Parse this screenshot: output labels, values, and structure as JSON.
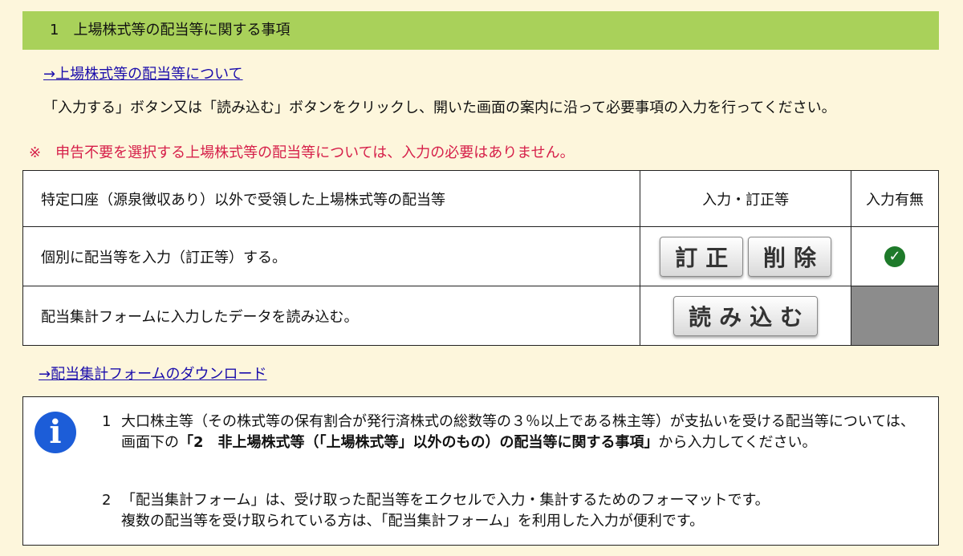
{
  "section": {
    "title": "1　上場株式等の配当等に関する事項",
    "about_link": "→上場株式等の配当等について",
    "instruction": "「入力する」ボタン又は「読み込む」ボタンをクリックし、開いた画面の案内に沿って必要事項の入力を行ってください。",
    "notice_mark": "※",
    "notice": "申告不要を選択する上場株式等の配当等については、入力の必要はありません。"
  },
  "table": {
    "headers": [
      "特定口座（源泉徴収あり）以外で受領した上場株式等の配当等",
      "入力・訂正等",
      "入力有無"
    ],
    "row1_label": "個別に配当等を入力（訂正等）する。",
    "row1_buttons": [
      "訂正",
      "削除"
    ],
    "row1_status": "✓",
    "row2_label": "配当集計フォームに入力したデータを読み込む。",
    "row2_button": "読み込む"
  },
  "download_link": "→配当集計フォームのダウンロード",
  "info": {
    "icon": "info-icon",
    "note1_num": "1",
    "note1_pre": "大口株主等（その株式等の保有割合が発行済株式の総数等の３％以上である株主等）が支払いを受ける配当等については、画面下の",
    "note1_bold": "「2　非上場株式等（「上場株式等」以外のもの）の配当等に関する事項」",
    "note1_post": "から入力してください。",
    "note2_num": "2",
    "note2_line1": "「配当集計フォーム」は、受け取った配当等をエクセルで入力・集計するためのフォーマットです。",
    "note2_line2": "複数の配当等を受け取られている方は、「配当集計フォーム」を利用した入力が便利です。"
  },
  "colors": {
    "header_bg": "#a9d15a",
    "page_bg": "#fdf6dc",
    "notice": "#d6204a",
    "link": "#1a0dab",
    "check": "#1e7a2a",
    "info_icon": "#1c5dd8"
  }
}
